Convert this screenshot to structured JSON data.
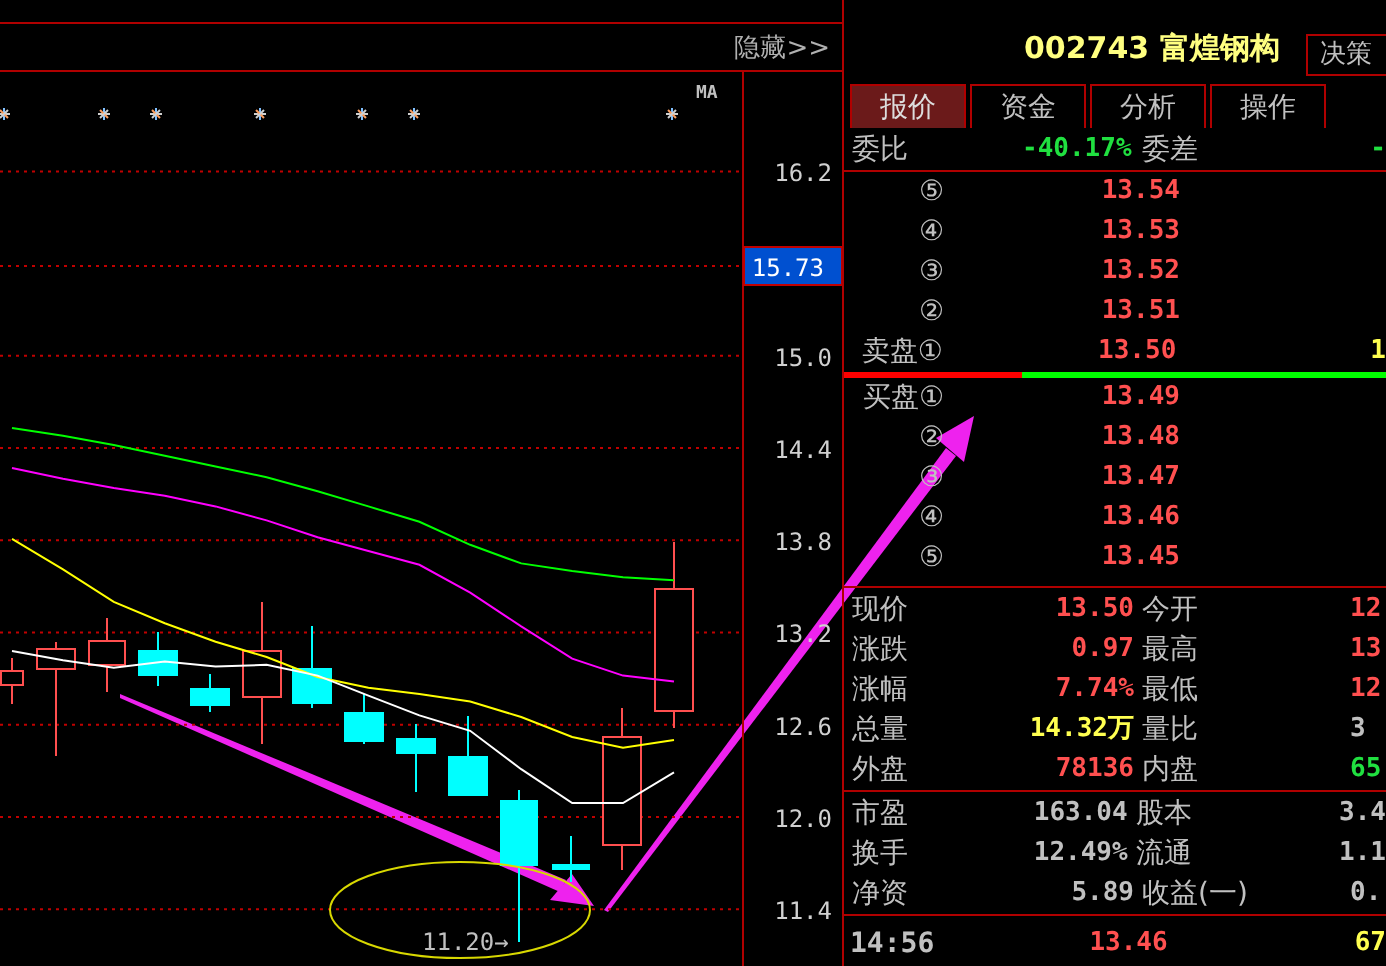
{
  "chart": {
    "hide_button": "隐藏>>",
    "ma_label": "MA",
    "current_price_tag": "15.73",
    "low_label": "11.20→",
    "chart_data": {
      "type": "line",
      "grid": true,
      "categories": [
        null,
        null,
        null,
        null,
        null,
        null,
        null,
        null,
        null,
        null,
        null,
        null,
        null,
        null
      ],
      "ylim": [
        11.03,
        16.86
      ],
      "yticks": [
        {
          "value": 16.2,
          "label": "16.2"
        },
        {
          "value": 15,
          "label": "15.0"
        },
        {
          "value": 14.4,
          "label": "14.4"
        },
        {
          "value": 13.8,
          "label": "13.8"
        },
        {
          "value": 13.2,
          "label": "13.2"
        },
        {
          "value": 12.6,
          "label": "12.6"
        },
        {
          "value": 12,
          "label": "12.0"
        },
        {
          "value": 11.4,
          "label": "11.4"
        }
      ],
      "series": [
        {
          "color": "#00ff00",
          "values": [
            14.53,
            14.48,
            14.42,
            14.35,
            14.28,
            14.21,
            14.12,
            14.02,
            13.92,
            13.77,
            13.65,
            13.6,
            13.56,
            13.54
          ]
        },
        {
          "color": "#ff00ff",
          "values": [
            14.27,
            14.2,
            14.14,
            14.09,
            14.02,
            13.93,
            13.82,
            13.73,
            13.64,
            13.46,
            13.24,
            13.03,
            12.92,
            12.88
          ]
        },
        {
          "color": "#ffff00",
          "values": [
            13.81,
            13.61,
            13.4,
            13.26,
            13.14,
            13.04,
            12.91,
            12.84,
            12.8,
            12.75,
            12.65,
            12.52,
            12.45,
            12.5
          ]
        },
        {
          "color": "#ffffff",
          "values": [
            13.08,
            13.02,
            12.97,
            13.01,
            12.98,
            12.99,
            12.92,
            12.79,
            12.66,
            12.56,
            12.31,
            12.09,
            12.09,
            12.29
          ]
        }
      ]
    }
  },
  "quote": {
    "code": "002743",
    "name": "富煌钢构",
    "decision_button": "决策",
    "tabs": [
      {
        "label": "报价",
        "selected": true
      },
      {
        "label": "资金",
        "selected": false
      },
      {
        "label": "分析",
        "selected": false
      },
      {
        "label": "操作",
        "selected": false
      }
    ],
    "order_ratio": {
      "label": "委比",
      "value": "-40.17%",
      "diff_label": "委差",
      "diff_value": "-"
    },
    "asks": [
      {
        "label": "⑤",
        "price": "13.54"
      },
      {
        "label": "④",
        "price": "13.53"
      },
      {
        "label": "③",
        "price": "13.52"
      },
      {
        "label": "②",
        "price": "13.51"
      },
      {
        "label": "卖盘①",
        "price": "13.50",
        "volume": "1"
      }
    ],
    "depth_bar": {
      "level": 0.33
    },
    "bids": [
      {
        "label": "买盘①",
        "price": "13.49"
      },
      {
        "label": "②",
        "price": "13.48"
      },
      {
        "label": "③",
        "price": "13.47"
      },
      {
        "label": "④",
        "price": "13.46"
      },
      {
        "label": "⑤",
        "price": "13.45"
      }
    ],
    "stats": [
      {
        "cells": [
          {
            "label": "现价",
            "value": "13.50",
            "color": "#ff5050"
          },
          {
            "label": "今开",
            "value": "12",
            "color": "#ff5050"
          }
        ]
      },
      {
        "cells": [
          {
            "label": "涨跌",
            "value": "0.97",
            "color": "#ff5050"
          },
          {
            "label": "最高",
            "value": "13",
            "color": "#ff5050"
          }
        ]
      },
      {
        "cells": [
          {
            "label": "涨幅",
            "value": "7.74%",
            "color": "#ff5050"
          },
          {
            "label": "最低",
            "value": "12",
            "color": "#ff5050"
          }
        ]
      },
      {
        "cells": [
          {
            "label": "总量",
            "value": "14.32万",
            "color": "#ffff50"
          },
          {
            "label": "量比",
            "value": "3",
            "color": "#c0c0c0"
          }
        ]
      },
      {
        "cells": [
          {
            "label": "外盘",
            "value": "78136",
            "color": "#ff5050"
          },
          {
            "label": "内盘",
            "value": "65",
            "color": "#20e040"
          }
        ]
      }
    ],
    "fundamentals": [
      {
        "cells": [
          {
            "label": "市盈",
            "value": "163.04"
          },
          {
            "label": "股本",
            "value": "3.4"
          }
        ]
      },
      {
        "cells": [
          {
            "label": "换手",
            "value": "12.49%"
          },
          {
            "label": "流通",
            "value": "1.1"
          }
        ]
      },
      {
        "cells": [
          {
            "label": "净资",
            "value": "5.89"
          },
          {
            "label": "收益(一)",
            "value": "0."
          }
        ]
      }
    ],
    "ticks": [
      {
        "time": "14:56",
        "price": "13.46",
        "volume": "67"
      }
    ]
  }
}
